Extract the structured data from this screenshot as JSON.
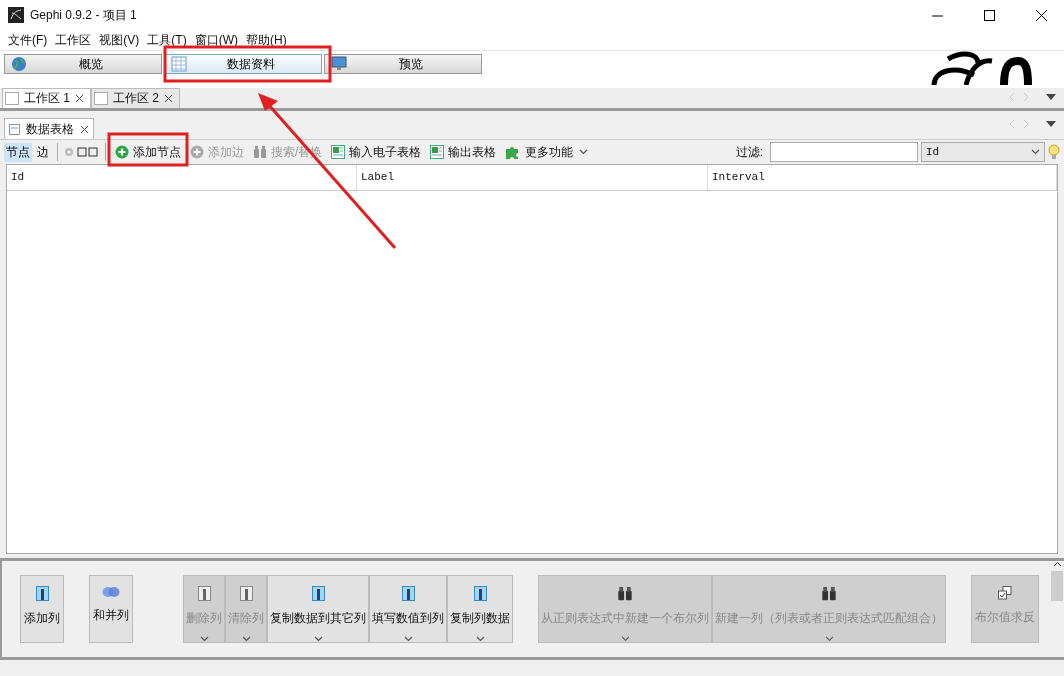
{
  "window": {
    "title": "Gephi 0.9.2 - 项目 1"
  },
  "menu": [
    "文件(F)",
    "工作区",
    "视图(V)",
    "工具(T)",
    "窗口(W)",
    "帮助(H)"
  ],
  "perspectives": [
    {
      "label": "概览",
      "kind": "globe",
      "selected": false
    },
    {
      "label": "数据资料",
      "kind": "table",
      "selected": true
    },
    {
      "label": "预览",
      "kind": "monitor",
      "selected": false
    }
  ],
  "workspace_tabs": [
    {
      "label": "工作区 1",
      "selected": true
    },
    {
      "label": "工作区 2",
      "selected": false
    }
  ],
  "panel_tab": {
    "label": "数据表格"
  },
  "toolbar": {
    "modes": [
      {
        "label": "节点",
        "selected": true
      },
      {
        "label": "边",
        "selected": false
      }
    ],
    "actions": [
      {
        "label": "添加节点",
        "kind": "add",
        "disabled": false
      },
      {
        "label": "添加边",
        "kind": "add",
        "disabled": true
      },
      {
        "label": "搜索/替换",
        "kind": "binoculars",
        "disabled": true
      },
      {
        "label": "输入电子表格",
        "kind": "sheet",
        "disabled": false
      },
      {
        "label": "输出表格",
        "kind": "sheet",
        "disabled": false
      },
      {
        "label": "更多功能",
        "kind": "puzzle",
        "disabled": false
      }
    ],
    "filter_label": "过滤:",
    "filter_column": "Id"
  },
  "table": {
    "columns": [
      "Id",
      "Label",
      "Interval"
    ]
  },
  "column_buttons": [
    {
      "label": "添加列",
      "kind": "column",
      "disabled": false,
      "dropdown": false
    },
    {
      "label": "和并列",
      "kind": "merge",
      "disabled": false,
      "dropdown": false
    },
    {
      "label": "删除列",
      "kind": "column",
      "disabled": true,
      "dropdown": true
    },
    {
      "label": "清除列",
      "kind": "column",
      "disabled": true,
      "dropdown": true
    },
    {
      "label": "复制数据到其它列",
      "kind": "column",
      "disabled": false,
      "dropdown": true
    },
    {
      "label": "填写数值到列",
      "kind": "column",
      "disabled": false,
      "dropdown": true
    },
    {
      "label": "复制列数据",
      "kind": "column",
      "disabled": false,
      "dropdown": true
    },
    {
      "label": "从正则表达式中新建一个布尔列",
      "kind": "binoculars",
      "disabled": true,
      "dropdown": true
    },
    {
      "label": "新建一列（列表或者正则表达式匹配组合）",
      "kind": "binoculars",
      "disabled": true,
      "dropdown": true
    },
    {
      "label": "布尔值求反",
      "kind": "toggle",
      "disabled": true,
      "dropdown": false
    }
  ]
}
